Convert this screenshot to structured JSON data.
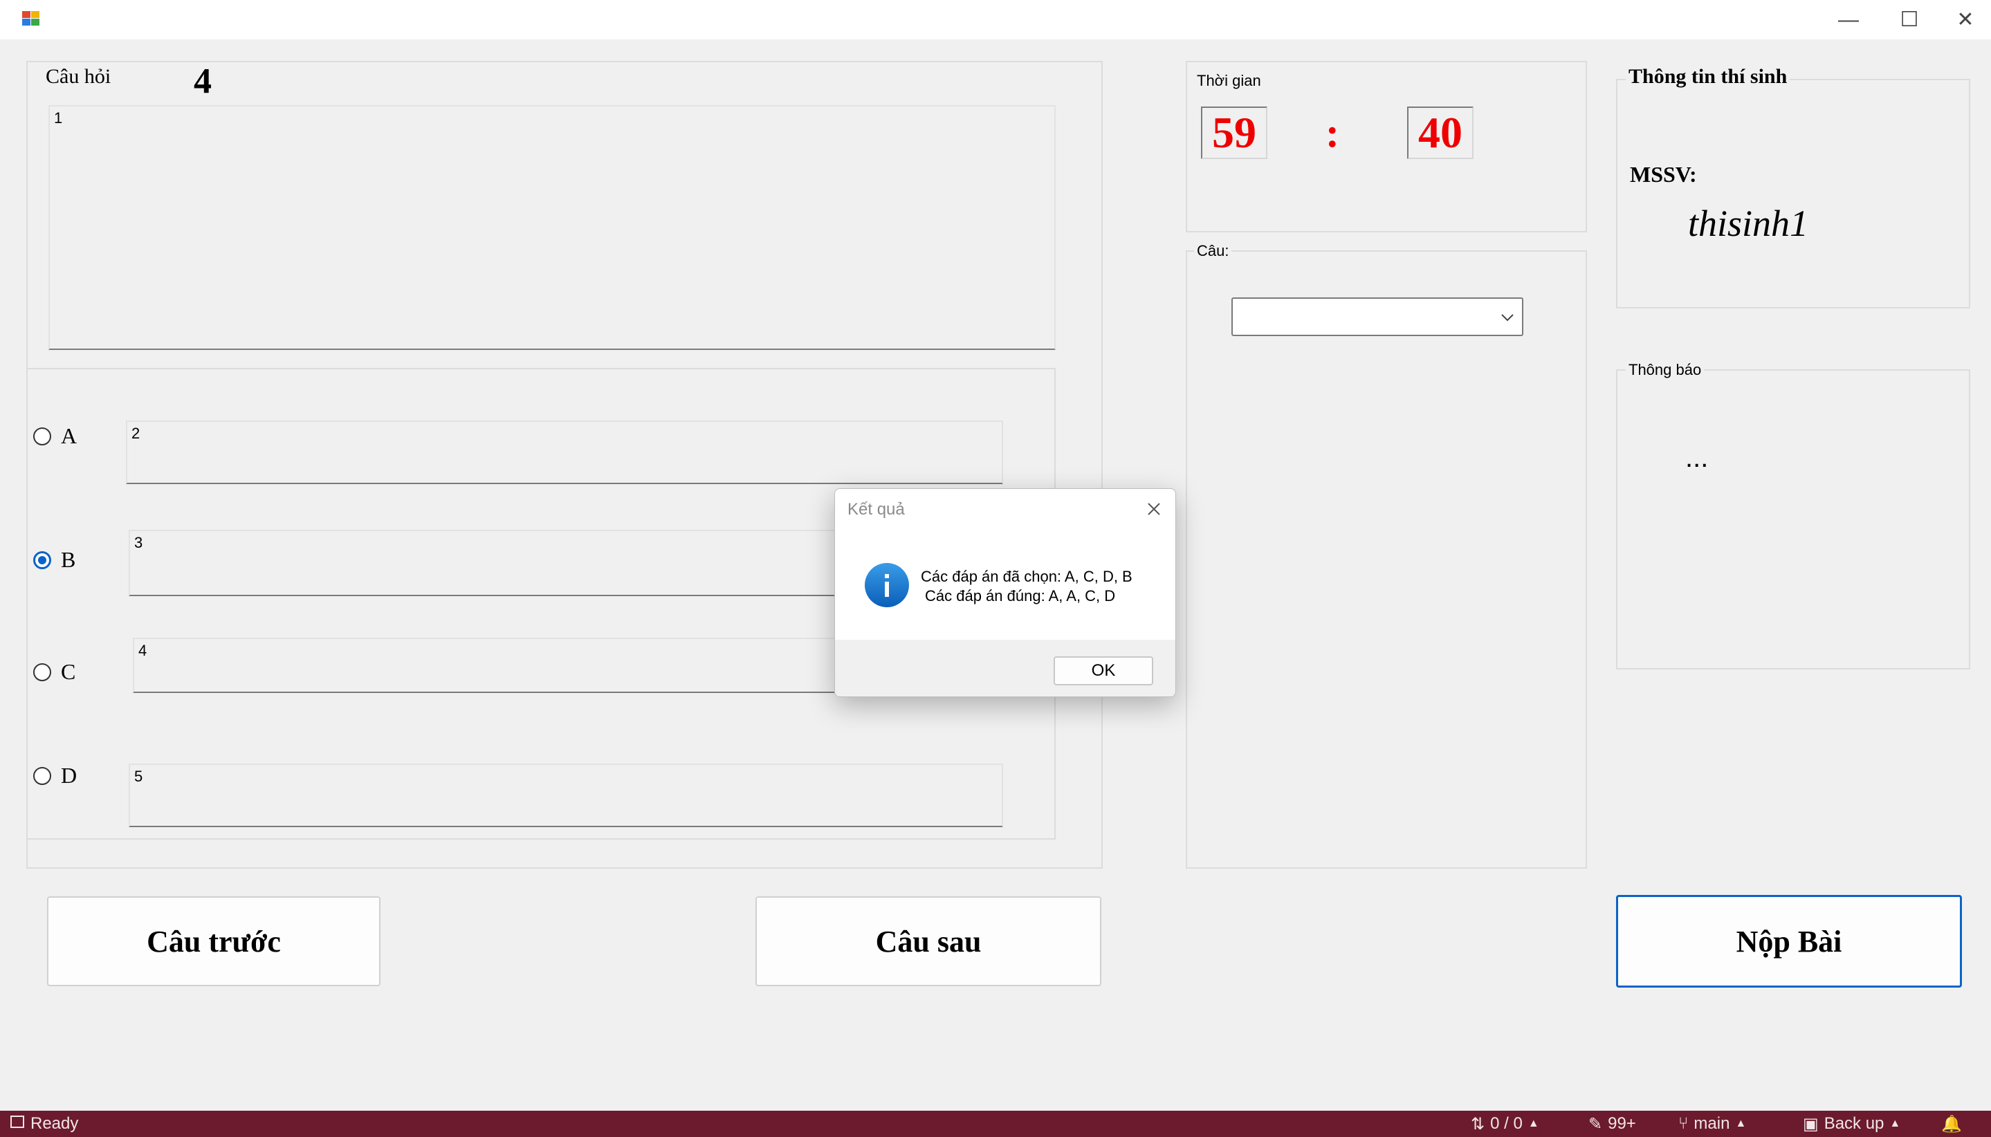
{
  "window": {
    "minimize_glyph": "—",
    "maximize_glyph": "☐",
    "close_glyph": "✕"
  },
  "question": {
    "group_title": "Câu hỏi",
    "number": "4",
    "text": "1"
  },
  "options": [
    {
      "label": "A",
      "text": "2",
      "checked": false
    },
    {
      "label": "B",
      "text": "3",
      "checked": true
    },
    {
      "label": "C",
      "text": "4",
      "checked": false
    },
    {
      "label": "D",
      "text": "5",
      "checked": false
    }
  ],
  "timer": {
    "group_title": "Thời gian",
    "minutes": "59",
    "separator": ":",
    "seconds": "40"
  },
  "question_select": {
    "group_title": "Câu:",
    "value": ""
  },
  "student_info": {
    "group_title": "Thông tin thí sinh",
    "mssv_label": "MSSV:",
    "mssv_value": "thisinh1"
  },
  "notice": {
    "group_title": "Thông báo",
    "text": "..."
  },
  "buttons": {
    "prev": "Câu trước",
    "next": "Câu sau",
    "submit": "Nộp Bài"
  },
  "dialog": {
    "title": "Kết quả",
    "line1": "Các đáp án đã chọn: A, C, D, B",
    "line2": "Các đáp án đúng: A, A, C, D",
    "ok": "OK",
    "icon": "info-icon"
  },
  "statusbar": {
    "ready": "Ready",
    "changes": "0 / 0",
    "pending": "99+",
    "branch": "main",
    "backup": "Back up"
  },
  "colors": {
    "timer": "#ee0000",
    "accent": "#0a64c8",
    "statusbar": "#6b1b2d"
  }
}
